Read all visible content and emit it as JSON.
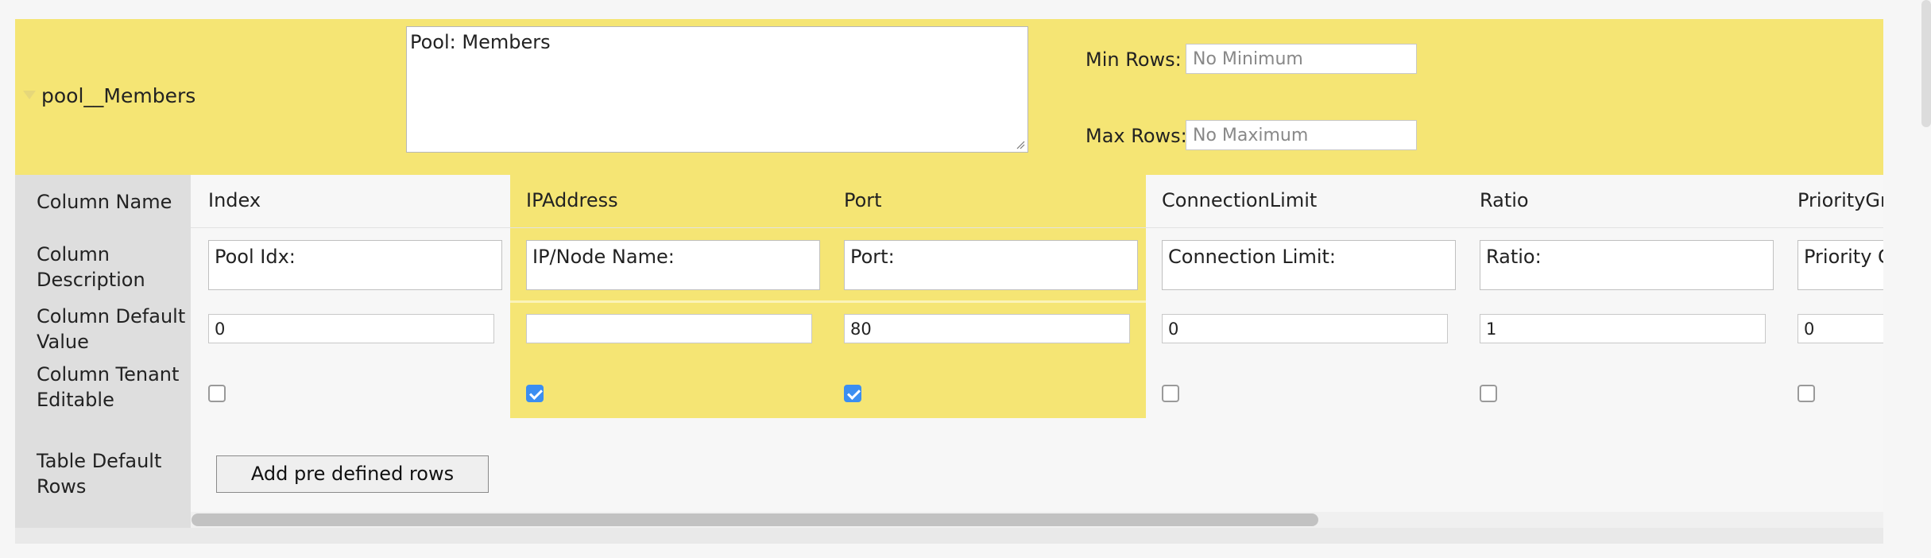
{
  "table": {
    "name": "pool__Members",
    "description": "Pool: Members",
    "min_rows_label": "Min Rows:",
    "min_rows_placeholder": "No Minimum",
    "max_rows_label": "Max Rows:",
    "max_rows_placeholder": "No Maximum"
  },
  "row_labels": {
    "column_name": "Column Name",
    "column_description": "Column Description",
    "column_default_value": "Column Default Value",
    "column_tenant_editable": "Column Tenant Editable",
    "table_default_rows": "Table Default Rows"
  },
  "columns": [
    {
      "name": "Index",
      "description": "Pool Idx:",
      "default": "0",
      "tenant_editable": false,
      "highlighted": false
    },
    {
      "name": "IPAddress",
      "description": "IP/Node Name:",
      "default": "",
      "tenant_editable": true,
      "highlighted": true
    },
    {
      "name": "Port",
      "description": "Port:",
      "default": "80",
      "tenant_editable": true,
      "highlighted": true
    },
    {
      "name": "ConnectionLimit",
      "description": "Connection Limit:",
      "default": "0",
      "tenant_editable": false,
      "highlighted": false
    },
    {
      "name": "Ratio",
      "description": "Ratio:",
      "default": "1",
      "tenant_editable": false,
      "highlighted": false
    },
    {
      "name": "PriorityGr",
      "description": "Priority G",
      "default": "0",
      "tenant_editable": false,
      "highlighted": false
    }
  ],
  "add_rows_button": "Add pre defined rows",
  "colors": {
    "highlight": "#f5e574",
    "checkbox_checked": "#3b8ef1",
    "label_column": "#dedede"
  },
  "icons": {
    "collapse": "triangle-down-icon",
    "checked": "checkbox-checked-icon",
    "unchecked": "checkbox-unchecked-icon"
  }
}
